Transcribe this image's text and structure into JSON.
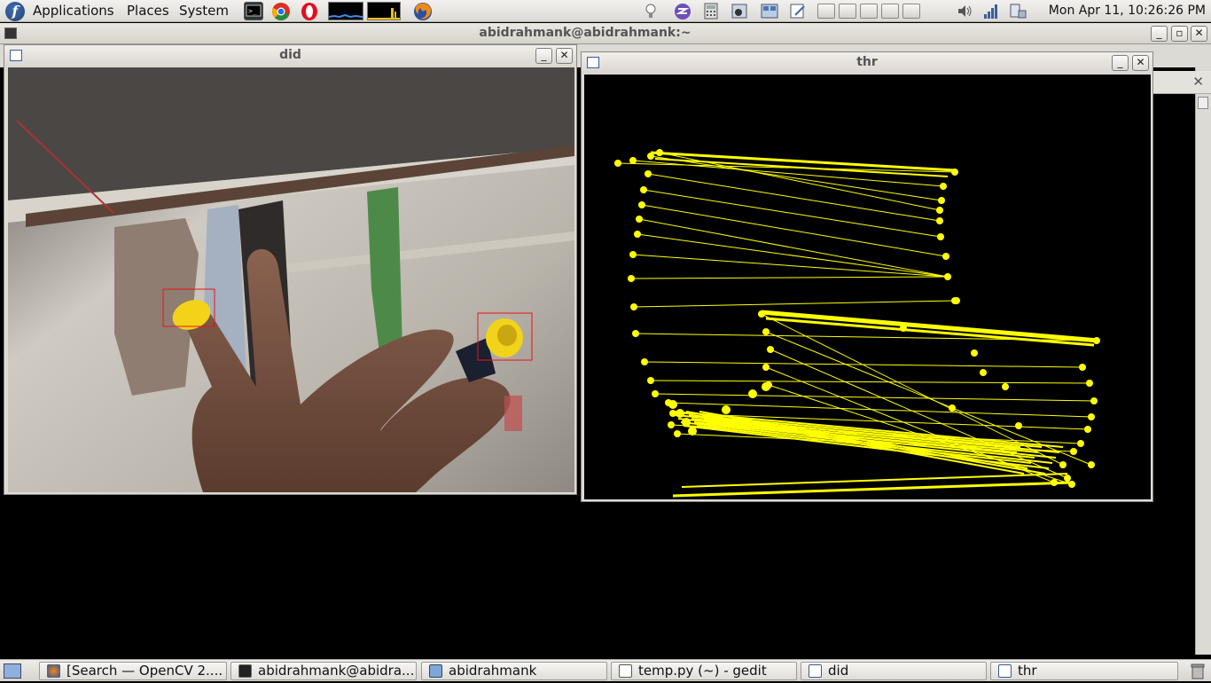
{
  "top_panel": {
    "menus": [
      "Applications",
      "Places",
      "System"
    ],
    "clock": "Mon Apr 11, 10:26:26 PM"
  },
  "terminal": {
    "title": "abidrahmank@abidrahmank:~"
  },
  "window_did": {
    "title": "did"
  },
  "window_thr": {
    "title": "thr"
  },
  "taskbar": {
    "tasks": [
      "[Search — OpenCV 2....",
      "abidrahmank@abidra...",
      "abidrahmank",
      "temp.py (~) - gedit",
      "did",
      "thr"
    ]
  },
  "icons": {
    "main_menu": "fedora-logo-icon",
    "launchers": [
      "terminal-icon",
      "chrome-icon",
      "opera-icon",
      "firefox-icon"
    ],
    "tray": [
      "volume-icon",
      "network-signal-icon",
      "network-manager-icon"
    ]
  },
  "colors": {
    "contour": "#ffff00",
    "detection_box": "#e8141a",
    "marker_cap": "#f3d21a"
  }
}
